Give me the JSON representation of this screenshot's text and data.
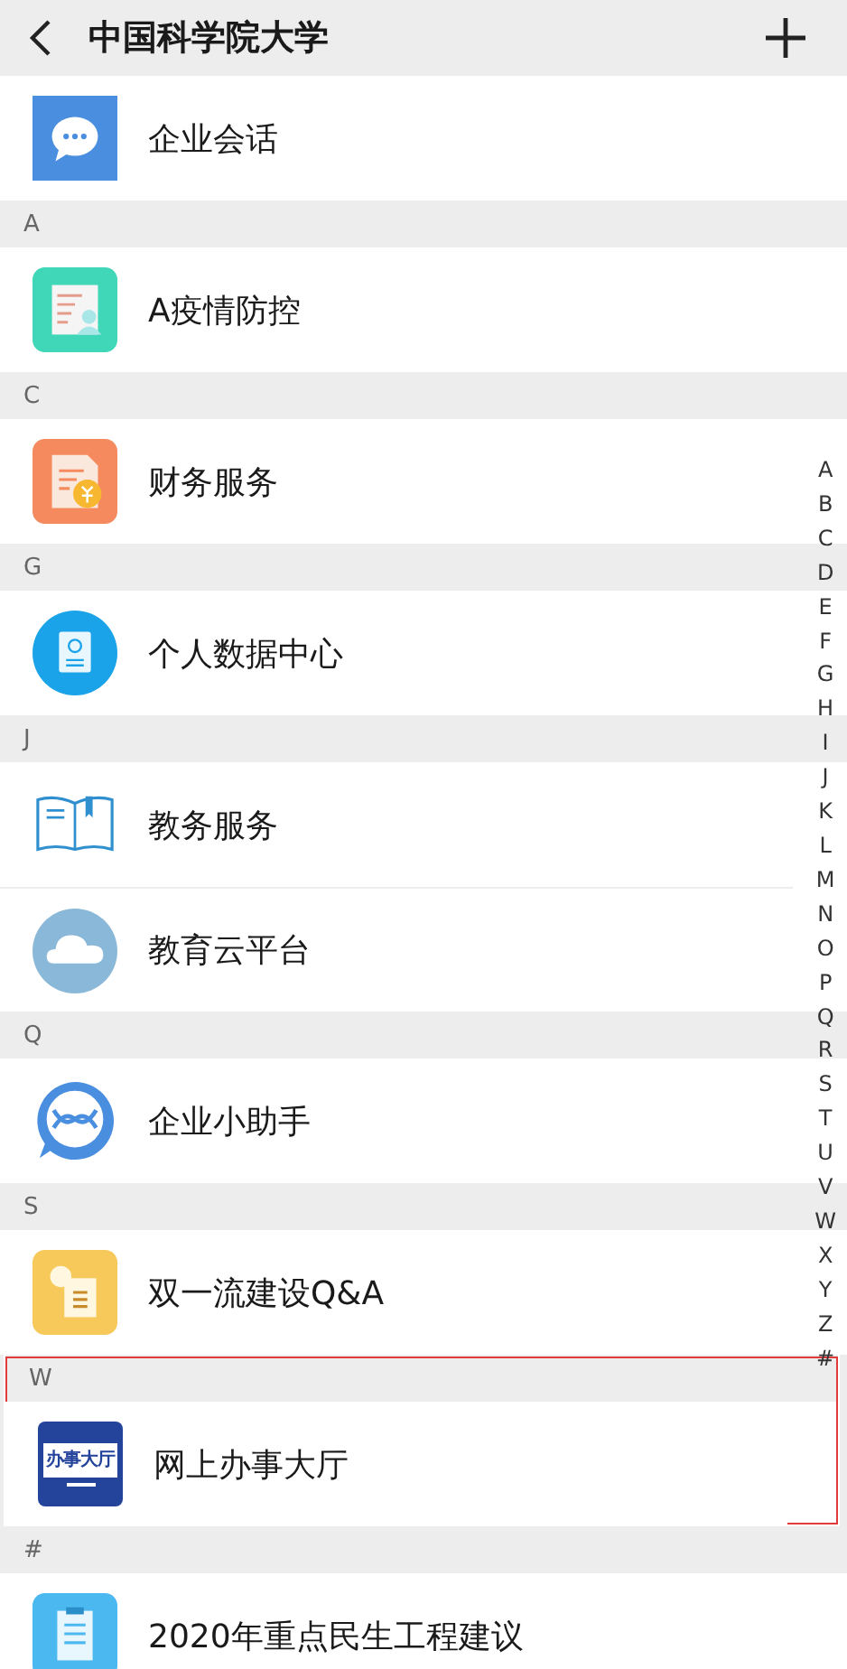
{
  "header": {
    "title": "中国科学院大学"
  },
  "groups": [
    {
      "items": [
        {
          "label": "企业会话"
        }
      ]
    },
    {
      "letter": "A",
      "items": [
        {
          "label": "A疫情防控"
        }
      ]
    },
    {
      "letter": "C",
      "items": [
        {
          "label": "财务服务"
        }
      ]
    },
    {
      "letter": "G",
      "items": [
        {
          "label": "个人数据中心"
        }
      ]
    },
    {
      "letter": "J",
      "items": [
        {
          "label": "教务服务"
        },
        {
          "label": "教育云平台"
        }
      ]
    },
    {
      "letter": "Q",
      "items": [
        {
          "label": "企业小助手"
        }
      ]
    },
    {
      "letter": "S",
      "items": [
        {
          "label": "双一流建设Q&A"
        }
      ]
    },
    {
      "letter": "W",
      "highlighted": true,
      "items": [
        {
          "label": "网上办事大厅",
          "icon_label": "办事大厅"
        }
      ]
    },
    {
      "letter": "#",
      "items": [
        {
          "label": "2020年重点民生工程建议"
        }
      ]
    }
  ],
  "index": [
    "A",
    "B",
    "C",
    "D",
    "E",
    "F",
    "G",
    "H",
    "I",
    "J",
    "K",
    "L",
    "M",
    "N",
    "O",
    "P",
    "Q",
    "R",
    "S",
    "T",
    "U",
    "V",
    "W",
    "X",
    "Y",
    "Z",
    "#"
  ]
}
